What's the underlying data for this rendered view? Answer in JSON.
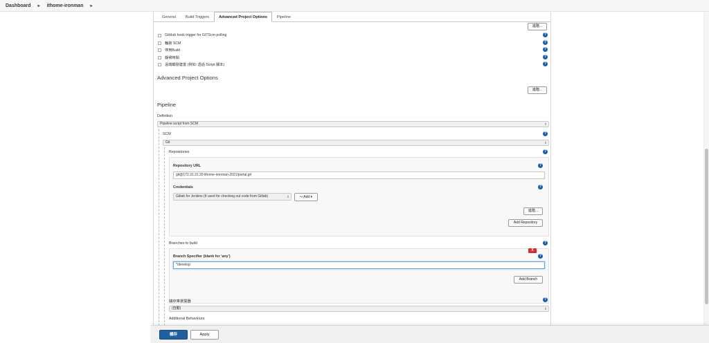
{
  "breadcrumb": {
    "items": [
      "Dashboard",
      "ithome-ironman"
    ]
  },
  "tabs": [
    "General",
    "Build Triggers",
    "Advanced Project Options",
    "Pipeline"
  ],
  "build_triggers": {
    "advanced_button": "進階...",
    "options": [
      "GitHub hook trigger for GITScm polling",
      "輪詢 SCM",
      "停用Build",
      "靜候時間",
      "遠端觸發建置 (例如: 透過 Script 腳本)"
    ]
  },
  "advanced_project_options": {
    "title": "Advanced Project Options",
    "advanced_button": "進階..."
  },
  "pipeline": {
    "title": "Pipeline",
    "definition_label": "Definition",
    "definition_value": "Pipeline script from SCM",
    "scm_label": "SCM",
    "scm_value": "Git",
    "repositories_label": "Repositories",
    "repo_url_label": "Repository URL",
    "repo_url_value": "git@172.31.31.20:ithome-ironman-2021/portal.git",
    "credentials_label": "Credentials",
    "credentials_value": "Gitlab for Jenkins (It used for checking out code from Gitlab)",
    "add_button": "Add",
    "repo_advanced_button": "進階...",
    "add_repository_button": "Add Repository",
    "branches_label": "Branches to build",
    "delete_label": "X",
    "branch_specifier_label": "Branch Specifier (blank for 'any')",
    "branch_specifier_value": "*/develop",
    "add_branch_button": "Add Branch",
    "browser_label": "儲存庫瀏覽器",
    "browser_value": "(自動)",
    "additional_behaviours_label": "Additional Behaviours"
  },
  "footer": {
    "save_button": "儲存",
    "apply_button": "Apply"
  },
  "help_glyph": "?",
  "colors": {
    "save_button_bg": "#1f5f9e",
    "help_icon": "#1a5fa8",
    "delete_button": "#d32f2f",
    "focus_border": "#6a9fd4"
  }
}
